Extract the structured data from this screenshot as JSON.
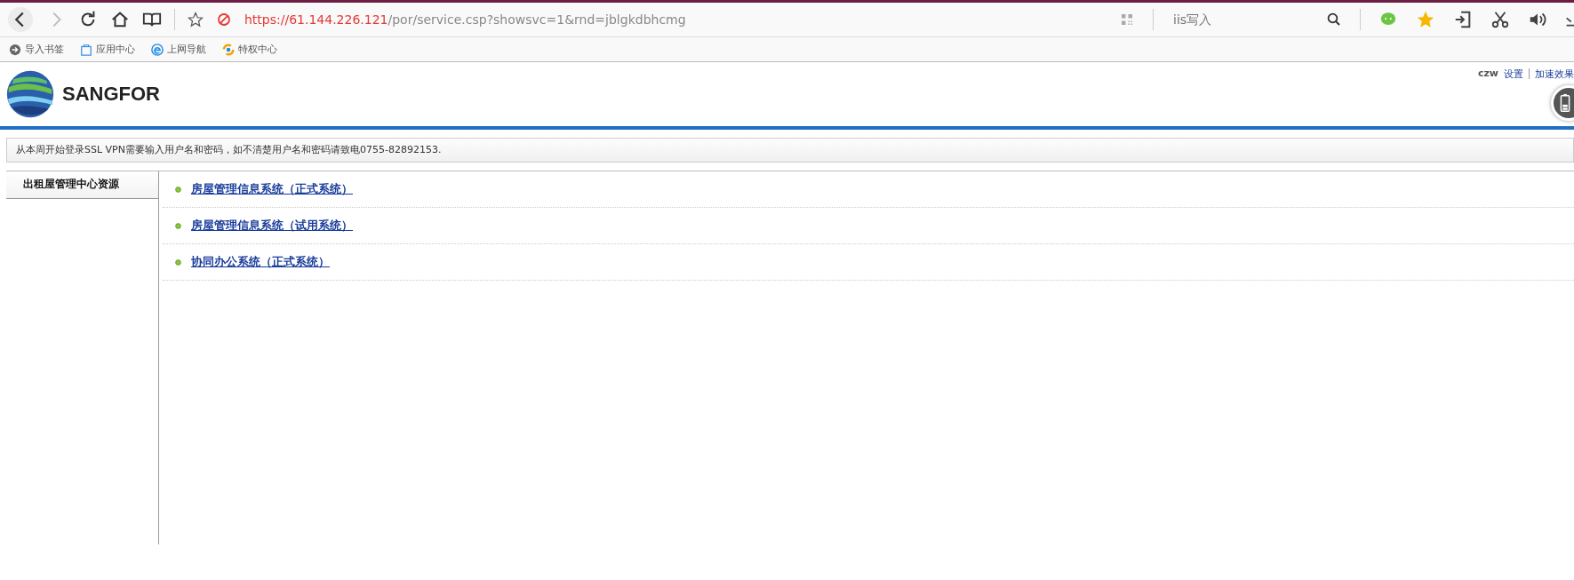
{
  "browser": {
    "url_secure_part": "https://61.144.226.121",
    "url_path": "/por/service.csp?showsvc=1&rnd=jblgkdbhcmg",
    "search_placeholder": "iis写入",
    "bookmarks": [
      {
        "label": "导入书签",
        "kind": "import"
      },
      {
        "label": "应用中心",
        "kind": "apps"
      },
      {
        "label": "上网导航",
        "kind": "ie"
      },
      {
        "label": "特权中心",
        "kind": "privilege"
      }
    ]
  },
  "header": {
    "logo_text": "SANGFOR",
    "user": "czw",
    "links": [
      "设置",
      "加速效果"
    ]
  },
  "notice": "从本周开始登录SSL VPN需要输入用户名和密码，如不清楚用户名和密码请致电0755-82892153.",
  "tabs": [
    {
      "label": "出租屋管理中心资源",
      "selected": true
    }
  ],
  "resources": [
    "房屋管理信息系统（正式系统）",
    "房屋管理信息系统（试用系统）",
    "协同办公系统（正式系统）"
  ]
}
